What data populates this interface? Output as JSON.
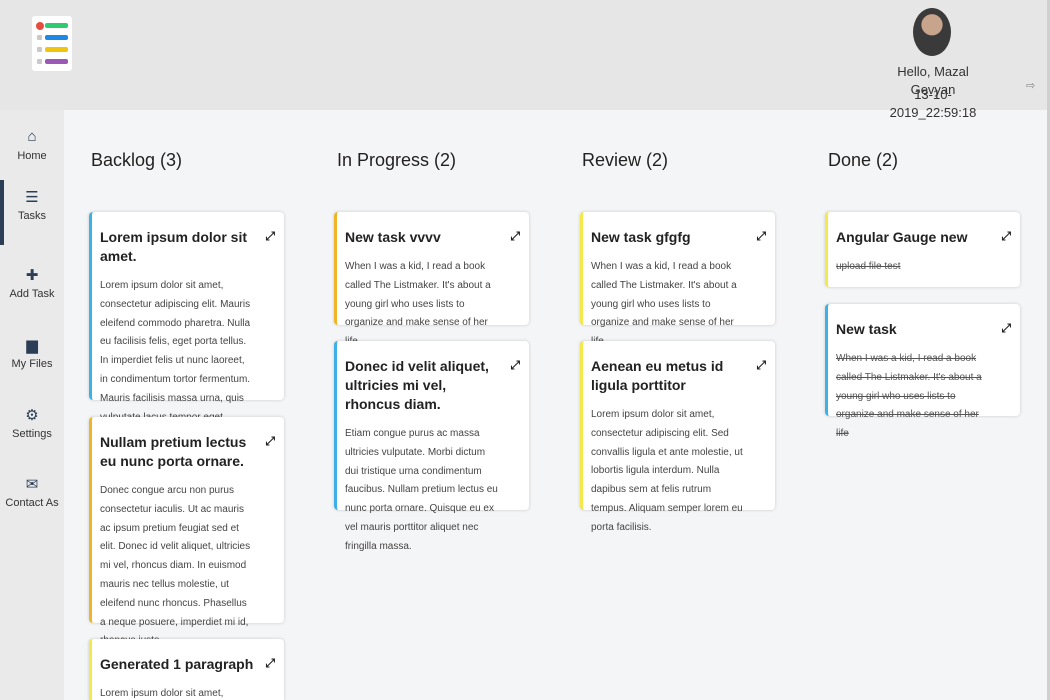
{
  "header": {
    "greeting": "Hello, Mazal Gevyan",
    "datetime": "13-10-2019_22:59:18",
    "logo_icon": "checklist-logo-icon",
    "logo_colors": [
      "#2ecc71",
      "#1e88e5",
      "#f1c40f",
      "#9b59b6"
    ],
    "logout_icon": "logout-icon",
    "logout_glyph": "⇨"
  },
  "sidebar": {
    "items": [
      {
        "label": "Home",
        "icon": "home-icon",
        "glyph": "⌂",
        "active": false
      },
      {
        "label": "Tasks",
        "icon": "list-icon",
        "glyph": "☰",
        "active": true
      },
      {
        "label": "Add Task",
        "icon": "plus-icon",
        "glyph": "✚",
        "active": false
      },
      {
        "label": "My Files",
        "icon": "file-icon",
        "glyph": "▆",
        "active": false
      },
      {
        "label": "Settings",
        "icon": "gear-icon",
        "glyph": "⚙",
        "active": false
      },
      {
        "label": "Contact As",
        "icon": "envelope-icon",
        "glyph": "✉",
        "active": false
      }
    ]
  },
  "board": {
    "expand_glyph": "⤢",
    "columns": [
      {
        "title": "Backlog (3)",
        "cards": [
          {
            "title": "Lorem ipsum dolor sit amet.",
            "body": "Lorem ipsum dolor sit amet, consectetur adipiscing elit. Mauris eleifend commodo pharetra. Nulla eu facilisis felis, eget porta tellus. In imperdiet felis ut nunc laoreet, in condimentum tortor fermentum. Mauris facilisis massa urna, quis vulputate lacus tempor eget. Pellentesque sollicitudin.",
            "color": "blue",
            "struck": false
          },
          {
            "title": "Nullam pretium lectus eu nunc porta ornare.",
            "body": "Donec congue arcu non purus consectetur iaculis. Ut ac mauris ac ipsum pretium feugiat sed et elit. Donec id velit aliquet, ultricies mi vel, rhoncus diam. In euismod mauris nec tellus molestie, ut eleifend nunc rhoncus. Phasellus a neque posuere, imperdiet mi id, rhoncus justo.",
            "color": "orange",
            "struck": false
          },
          {
            "title": "Generated 1 paragraph",
            "body": "Lorem ipsum dolor sit amet, consectetur",
            "color": "yellow",
            "struck": false
          }
        ]
      },
      {
        "title": "In Progress (2)",
        "cards": [
          {
            "title": "New task vvvv",
            "body": "When I was a kid, I read a book called The Listmaker. It's about a young girl who uses lists to organize and make sense of her life",
            "color": "orange",
            "struck": false
          },
          {
            "title": "Donec id velit aliquet, ultricies mi vel, rhoncus diam.",
            "body": "Etiam congue purus ac massa ultricies vulputate. Morbi dictum dui tristique urna condimentum faucibus. Nullam pretium lectus eu nunc porta ornare. Quisque eu ex vel mauris porttitor aliquet nec fringilla massa.",
            "color": "blue",
            "struck": false
          }
        ]
      },
      {
        "title": "Review (2)",
        "cards": [
          {
            "title": "New task gfgfg",
            "body": "When I was a kid, I read a book called The Listmaker. It's about a young girl who uses lists to organize and make sense of her life",
            "color": "yellow",
            "struck": false
          },
          {
            "title": "Aenean eu metus id ligula porttitor",
            "body": "Lorem ipsum dolor sit amet, consectetur adipiscing elit. Sed convallis ligula et ante molestie, ut lobortis ligula interdum. Nulla dapibus sem at felis rutrum tempus. Aliquam semper lorem eu porta facilisis.",
            "color": "yellow",
            "struck": false
          }
        ]
      },
      {
        "title": "Done (2)",
        "cards": [
          {
            "title": "Angular Gauge new",
            "body": "upload file test",
            "color": "yellow",
            "struck": true
          },
          {
            "title": "New task",
            "body": "When I was a kid, I read a book called The Listmaker. It's about a young girl who uses lists to organize and make sense of her life",
            "color": "blue",
            "struck": true
          }
        ]
      }
    ]
  }
}
